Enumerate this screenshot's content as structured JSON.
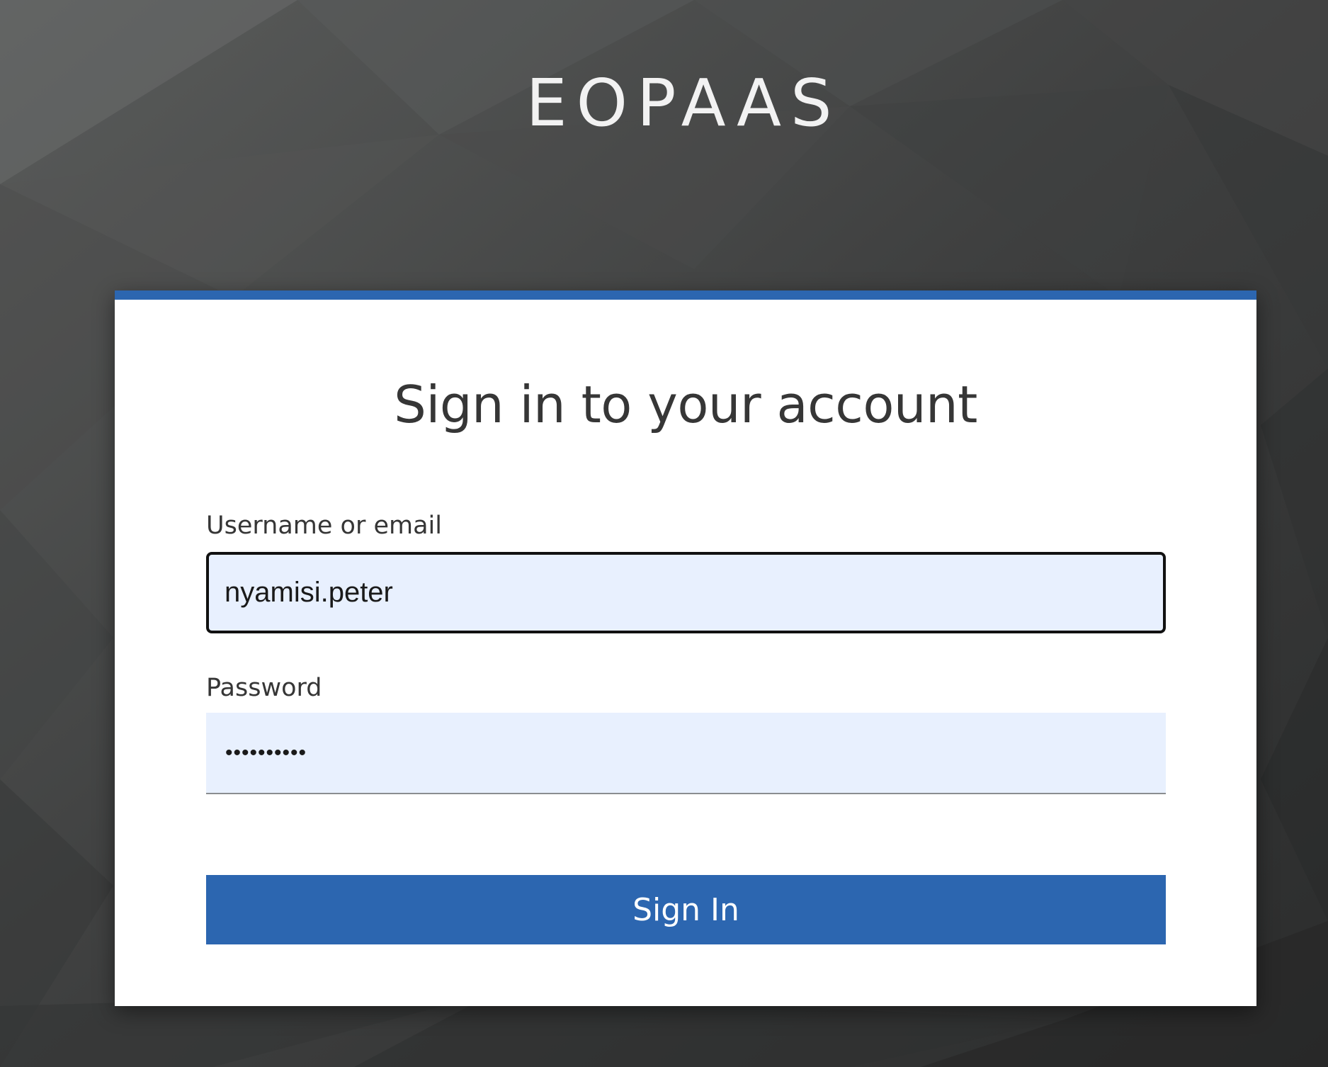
{
  "brand": {
    "name": "EOPAAS"
  },
  "login_form": {
    "title": "Sign in to your account",
    "username": {
      "label": "Username or email",
      "value": "nyamisi.peter"
    },
    "password": {
      "label": "Password",
      "masked_value": "••••••••••"
    },
    "submit_label": "Sign In"
  },
  "colors": {
    "accent": "#2c66b0",
    "input_fill": "#e8f0fe",
    "background": "#3a3b3b"
  }
}
